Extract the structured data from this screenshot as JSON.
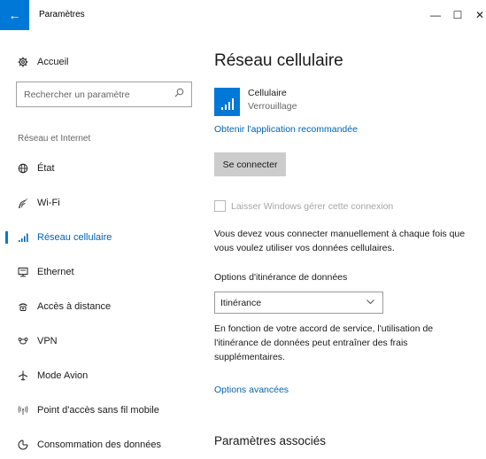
{
  "window": {
    "title": "Paramètres",
    "back_icon": "←",
    "minimize_icon": "—",
    "maximize_icon": "☐",
    "close_icon": "✕"
  },
  "sidebar": {
    "home": {
      "icon": "gear-icon",
      "label": "Accueil"
    },
    "search": {
      "placeholder": "Rechercher un paramètre"
    },
    "section_title": "Réseau et Internet",
    "items": [
      {
        "icon": "globe-icon",
        "label": "État",
        "active": false
      },
      {
        "icon": "wifi-icon",
        "label": "Wi-Fi",
        "active": false
      },
      {
        "icon": "cellular-icon",
        "label": "Réseau cellulaire",
        "active": true
      },
      {
        "icon": "ethernet-icon",
        "label": "Ethernet",
        "active": false
      },
      {
        "icon": "dialup-icon",
        "label": "Accès à distance",
        "active": false
      },
      {
        "icon": "vpn-icon",
        "label": "VPN",
        "active": false
      },
      {
        "icon": "airplane-icon",
        "label": "Mode Avion",
        "active": false
      },
      {
        "icon": "hotspot-icon",
        "label": "Point d'accès sans fil mobile",
        "active": false
      },
      {
        "icon": "data-usage-icon",
        "label": "Consommation des données",
        "active": false
      }
    ]
  },
  "main": {
    "title": "Réseau cellulaire",
    "cellular": {
      "name": "Cellulaire",
      "status": "Verrouillage"
    },
    "get_app_link": "Obtenir l'application recommandée",
    "connect_button": "Se connecter",
    "auto_manage": {
      "label": "Laisser Windows gérer cette connexion",
      "checked": false,
      "enabled": false
    },
    "info_text": "Vous devez vous connecter manuellement à chaque fois que vous voulez utiliser vos données cellulaires.",
    "roaming": {
      "label": "Options d'itinérance de données",
      "selected": "Itinérance",
      "description": "En fonction de votre accord de service, l'utilisation de l'itinérance de données peut entraîner des frais supplémentaires."
    },
    "advanced_link": "Options avancées",
    "related_title": "Paramètres associés"
  },
  "colors": {
    "accent": "#0078d7",
    "link": "#0063b1",
    "button_bg": "#cccccc",
    "disabled_text": "#a6a6a6"
  }
}
